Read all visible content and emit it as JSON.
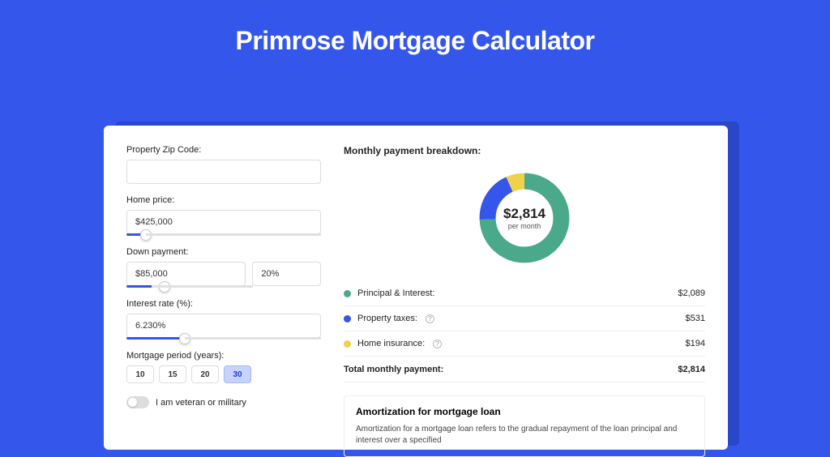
{
  "title": "Primrose Mortgage Calculator",
  "colors": {
    "principal": "#4aa98b",
    "taxes": "#3456eb",
    "insurance": "#efd24a"
  },
  "form": {
    "zip": {
      "label": "Property Zip Code:",
      "value": ""
    },
    "price": {
      "label": "Home price:",
      "value": "$425,000",
      "slider_pct": 10
    },
    "down": {
      "label": "Down payment:",
      "amount": "$85,000",
      "pct": "20%",
      "slider_pct": 20
    },
    "rate": {
      "label": "Interest rate (%):",
      "value": "6.230%",
      "slider_pct": 30
    },
    "period": {
      "label": "Mortgage period (years):",
      "options": [
        "10",
        "15",
        "20",
        "30"
      ],
      "selected": "30"
    },
    "veteran": {
      "label": "I am veteran or military",
      "checked": false
    }
  },
  "breakdown": {
    "title": "Monthly payment breakdown:",
    "center_amount": "$2,814",
    "center_sub": "per month",
    "items": [
      {
        "label": "Principal & Interest:",
        "value": "$2,089",
        "color_key": "principal",
        "help": false
      },
      {
        "label": "Property taxes:",
        "value": "$531",
        "color_key": "taxes",
        "help": true
      },
      {
        "label": "Home insurance:",
        "value": "$194",
        "color_key": "insurance",
        "help": true
      }
    ],
    "total": {
      "label": "Total monthly payment:",
      "value": "$2,814"
    }
  },
  "chart_data": {
    "type": "pie",
    "title": "Monthly payment breakdown",
    "series": [
      {
        "name": "Principal & Interest",
        "value": 2089,
        "color": "#4aa98b"
      },
      {
        "name": "Property taxes",
        "value": 531,
        "color": "#3456eb"
      },
      {
        "name": "Home insurance",
        "value": 194,
        "color": "#efd24a"
      }
    ],
    "total": 2814,
    "unit": "USD per month"
  },
  "amortization": {
    "title": "Amortization for mortgage loan",
    "text": "Amortization for a mortgage loan refers to the gradual repayment of the loan principal and interest over a specified"
  }
}
